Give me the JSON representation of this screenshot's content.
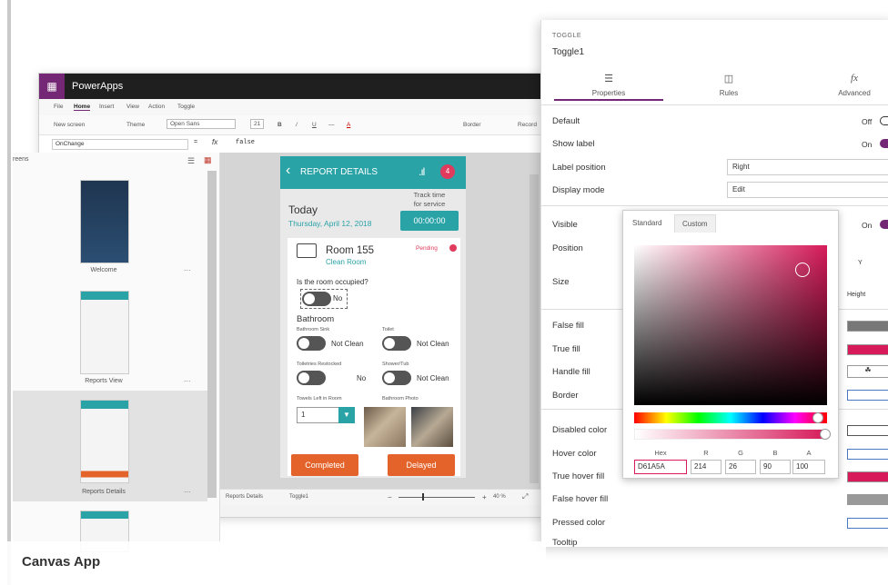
{
  "studio": {
    "app_title": "PowerApps",
    "menu": [
      "File",
      "Home",
      "Insert",
      "View",
      "Action",
      "Toggle"
    ],
    "menu_active": "Home",
    "ribbon": {
      "new_screen": "New screen",
      "theme": "Theme",
      "font": "Open Sans",
      "font_size": "21",
      "border": "Border",
      "record": "Record"
    },
    "formula": {
      "property": "OnChange",
      "fx": "fx",
      "value": "false"
    }
  },
  "screens_pane": {
    "title": "reens",
    "screens": [
      {
        "label": "Welcome"
      },
      {
        "label": "Reports View"
      },
      {
        "label": "Reports Details"
      },
      {
        "label": ""
      }
    ],
    "more": "..."
  },
  "status_bar": {
    "screen": "Reports Details",
    "control": "Toggle1",
    "zoom": "40 %"
  },
  "phone": {
    "header_title": "REPORT DETAILS",
    "badge_count": "4",
    "today": "Today",
    "date": "Thursday, April 12, 2018",
    "track_time_1": "Track time",
    "track_time_2": "for service",
    "timer": "00:00:00",
    "room_title": "Room 155",
    "room_sub": "Clean Room",
    "pending": "Pending",
    "occupied_q": "Is the room occupied?",
    "occupied_val": "No",
    "bathroom": "Bathroom",
    "sink_label": "Bathroom Sink",
    "sink_val": "Not Clean",
    "toilet_label": "Toilet",
    "toilet_val": "Not Clean",
    "toiletries_label": "Toiletries Restocked",
    "toiletries_val": "No",
    "shower_label": "Shower/Tub",
    "shower_val": "Not Clean",
    "towels_label": "Towels Left in Room",
    "towels_val": "1",
    "photo_label": "Bathroom Photo",
    "completed": "Completed",
    "delayed": "Delayed"
  },
  "properties": {
    "kind": "TOGGLE",
    "name": "Toggle1",
    "tabs": [
      {
        "label": "Properties",
        "icon": "sliders-icon"
      },
      {
        "label": "Rules",
        "icon": "rules-icon"
      },
      {
        "label": "Advanced",
        "icon": "fx-icon"
      }
    ],
    "rows": {
      "default_label": "Default",
      "default_val": "Off",
      "show_label": "Show label",
      "show_label_val": "On",
      "label_position": "Label position",
      "label_position_val": "Right",
      "display_mode": "Display mode",
      "display_mode_val": "Edit",
      "visible": "Visible",
      "visible_val": "On",
      "position": "Position",
      "size": "Size",
      "y_head": "Y",
      "height_head": "Height",
      "false_fill": "False fill",
      "true_fill": "True fill",
      "handle_fill": "Handle fill",
      "border": "Border",
      "disabled_color": "Disabled color",
      "hover_color": "Hover color",
      "true_hover_fill": "True hover fill",
      "false_hover_fill": "False hover fill",
      "pressed_color": "Pressed color",
      "tooltip": "Tooltip"
    }
  },
  "picker": {
    "tab_standard": "Standard",
    "tab_custom": "Custom",
    "hex_head": "Hex",
    "r_head": "R",
    "g_head": "G",
    "b_head": "B",
    "a_head": "A",
    "hex": "D61A5A",
    "r": "214",
    "g": "26",
    "b": "90",
    "a": "100"
  },
  "caption": "Canvas App",
  "colors": {
    "accent_purple": "#742774",
    "teal": "#2aa3a7",
    "orange": "#e4632a",
    "pink": "#d61a5a"
  }
}
